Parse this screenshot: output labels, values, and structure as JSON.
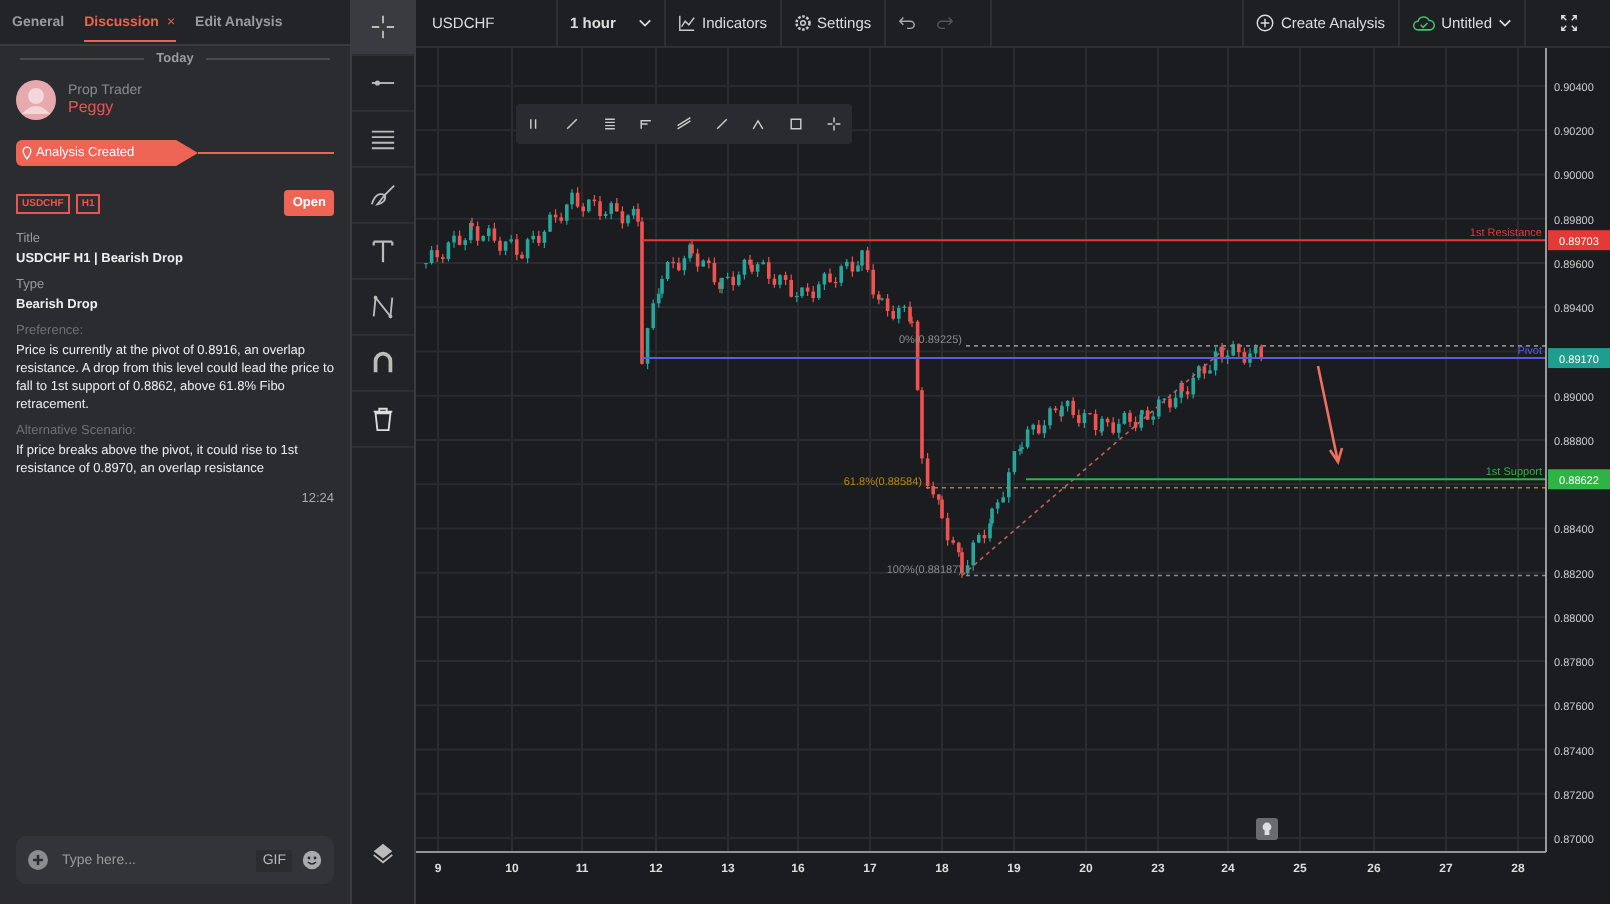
{
  "panel": {
    "tabs": [
      {
        "label": "General",
        "selected": false,
        "closable": false
      },
      {
        "label": "Discussion",
        "selected": true,
        "closable": true
      },
      {
        "label": "Edit Analysis",
        "selected": false,
        "closable": false
      }
    ],
    "close_mark": "×",
    "date_divider": "Today",
    "author": {
      "role": "Prop Trader",
      "name": "Peggy"
    },
    "event": "Analysis Created",
    "tags": [
      "USDCHF",
      "H1"
    ],
    "open_button": "Open",
    "fields": [
      {
        "label": "Title",
        "value": "USDCHF H1 | Bearish Drop",
        "kind": "heading"
      },
      {
        "label": "Type",
        "value": "Bearish Drop",
        "kind": "heading"
      },
      {
        "label": "Preference:",
        "value": "Price is currently at the pivot of 0.8916, an overlap resistance. A drop from this level could lead the price to fall to 1st support of 0.8862, above 61.8% Fibo retracement.",
        "kind": "paragraph"
      },
      {
        "label": "Alternative Scenario:",
        "value": "If price breaks above the pivot, it could rise to 1st resistance of 0.8970, an overlap resistance",
        "kind": "paragraph"
      }
    ],
    "time": "12:24",
    "composer": {
      "placeholder": "Type here...",
      "gif": "GIF"
    }
  },
  "toolbar": {
    "symbol": "USDCHF",
    "interval": "1 hour",
    "indicators": "Indicators",
    "settings": "Settings",
    "create": "Create Analysis",
    "save_name": "Untitled"
  },
  "chart": {
    "y_ticks": [
      "0.90400",
      "0.90200",
      "0.90000",
      "0.89800",
      "0.89600",
      "0.89400",
      "0.89000",
      "0.88800",
      "0.88400",
      "0.88200",
      "0.88000",
      "0.87800",
      "0.87600",
      "0.87400",
      "0.87200",
      "0.87000"
    ],
    "x_ticks": [
      "9",
      "10",
      "11",
      "12",
      "13",
      "16",
      "17",
      "18",
      "19",
      "20",
      "23",
      "24",
      "25",
      "26",
      "27",
      "28"
    ],
    "levels": [
      {
        "label": "1st Resistance",
        "value": "0.89703",
        "color": "#e53935"
      },
      {
        "label": "Pivot",
        "value": "0.89170",
        "color": "#5c5ce0"
      },
      {
        "label": "1st Support",
        "value": "0.88622",
        "color": "#2fb344"
      }
    ],
    "fib": [
      {
        "label": "0%(0.89225)",
        "color": "#8a8a8a"
      },
      {
        "label": "61.8%(0.88584)",
        "color": "#b8860b"
      },
      {
        "label": "100%(0.88187)",
        "color": "#8a8a8a"
      }
    ]
  }
}
